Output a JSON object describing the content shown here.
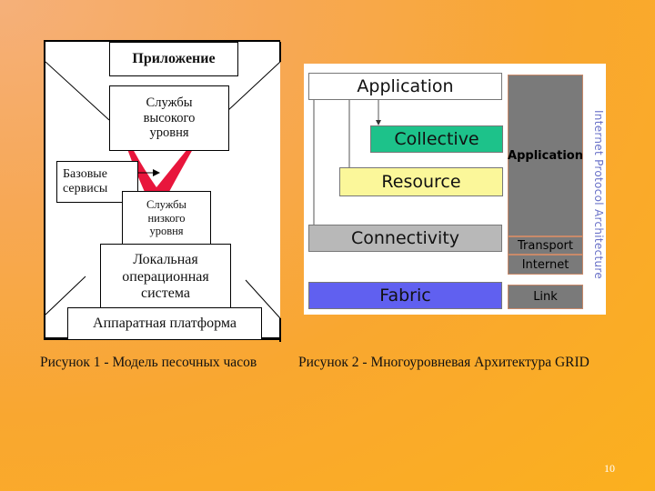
{
  "slide": {
    "page_number": "10",
    "background_colors": [
      "#f5b07a",
      "#f9a730",
      "#fbb01e"
    ]
  },
  "figure1": {
    "caption": "Рисунок 1 - Модель песочных часов",
    "boxes": {
      "application": "Приложение",
      "high_level_services": "Службы\nвысокого\nуровня",
      "base_services": "Базовые\nсервисы",
      "low_level_services": "Службы\nнизкого\nуровня",
      "local_os": "Локальная\nоперационная\nсистема",
      "hardware_platform": "Аппаратная платформа"
    },
    "arrow_color": "#e8163c"
  },
  "figure2": {
    "caption": "Рисунок 2 - Многоуровневая Архитектура GRID",
    "grid_layers": [
      {
        "label": "Application",
        "color": "#ffffff"
      },
      {
        "label": "Collective",
        "color": "#1dc28a"
      },
      {
        "label": "Resource",
        "color": "#fbf79a"
      },
      {
        "label": "Connectivity",
        "color": "#b8b8b8"
      },
      {
        "label": "Fabric",
        "color": "#6060f0"
      }
    ],
    "ip_layers": [
      {
        "label": "Application"
      },
      {
        "label": "Transport"
      },
      {
        "label": "Internet"
      },
      {
        "label": "Link"
      }
    ],
    "ip_title": "Internet Protocol Architecture",
    "ip_title_color": "#6a72c8",
    "ip_layer_color": "#7a7a7a"
  }
}
